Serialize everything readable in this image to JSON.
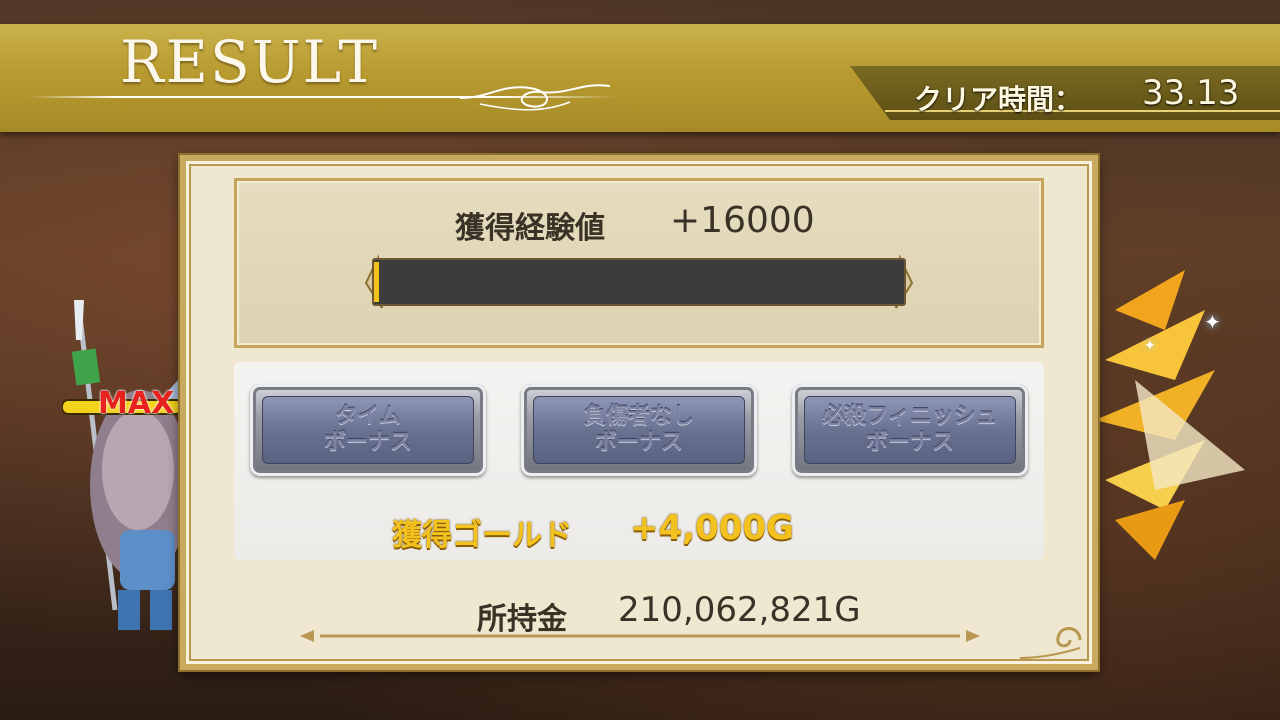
{
  "header": {
    "title": "RESULT",
    "clear_time_label": "クリア時間：",
    "clear_time_value": "33.13"
  },
  "exp": {
    "label": "獲得経験値",
    "value": "+16000",
    "bar_fill_fraction": 0.002
  },
  "bonuses": [
    {
      "line1": "タイム",
      "line2": "ボーナス"
    },
    {
      "line1": "負傷者なし",
      "line2": "ボーナス"
    },
    {
      "line1": "必殺フィニッシュ",
      "line2": "ボーナス"
    }
  ],
  "gold": {
    "label": "獲得ゴールド",
    "value": "+4,000G"
  },
  "money": {
    "label": "所持金",
    "value": "210,062,821G"
  },
  "party": {
    "status_badge": "MAX"
  },
  "colors": {
    "banner": "#b89b30",
    "gold_text": "#f3c21e",
    "exp_bar": "#3d3c3a",
    "exp_fill": "#f1c31b"
  }
}
